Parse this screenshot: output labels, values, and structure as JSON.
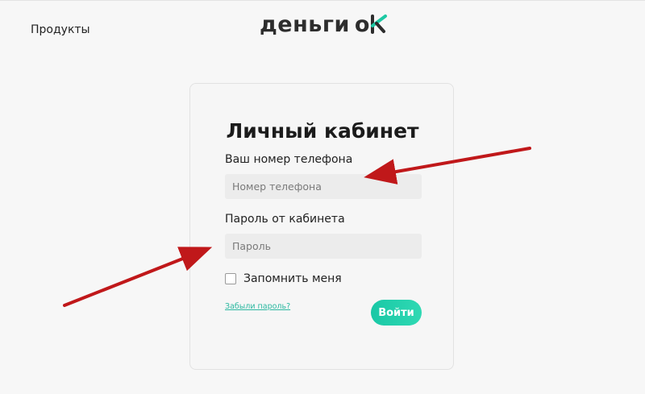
{
  "header": {
    "nav_products": "Продукты",
    "logo_main": "деньги",
    "logo_o": "o",
    "brand_accent": "#1dc9a4"
  },
  "login": {
    "title": "Личный кабинет",
    "phone_label": "Ваш номер телефона",
    "phone_placeholder": "Номер телефона",
    "password_label": "Пароль от кабинета",
    "password_placeholder": "Пароль",
    "remember_label": "Запомнить меня",
    "remember_checked": false,
    "forgot_link": "Забыли пароль?",
    "submit_label": "Войти"
  },
  "annotations": {
    "arrow_color": "#c0181a"
  }
}
